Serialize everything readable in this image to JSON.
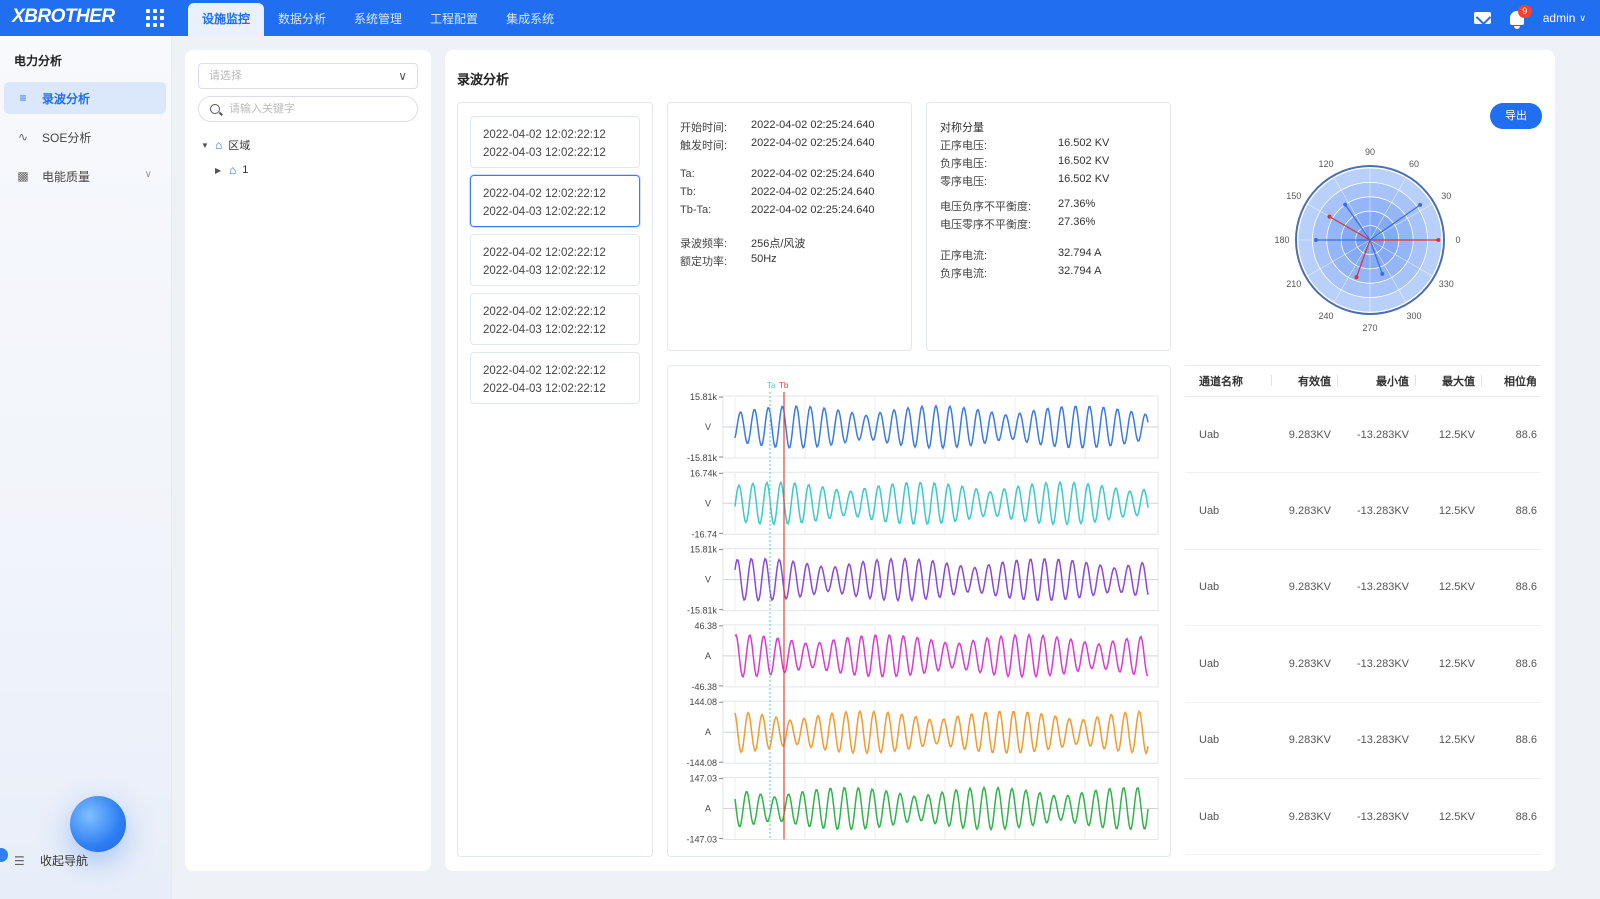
{
  "header": {
    "logo": "XBROTHER",
    "tabs": [
      "设施监控",
      "数据分析",
      "系统管理",
      "工程配置",
      "集成系统"
    ],
    "notification_count": "9",
    "user": "admin"
  },
  "sidebar": {
    "title": "电力分析",
    "items": [
      {
        "label": "录波分析",
        "icon": "list-icon",
        "active": true
      },
      {
        "label": "SOE分析",
        "icon": "wave-icon",
        "active": false
      },
      {
        "label": "电能质量",
        "icon": "meter-icon",
        "active": false
      }
    ],
    "collapse_label": "收起导航"
  },
  "tree": {
    "select_placeholder": "请选择",
    "search_placeholder": "请输入关键字",
    "nodes": [
      {
        "label": "区域",
        "expanded": true
      },
      {
        "label": "1",
        "expanded": false
      }
    ]
  },
  "main": {
    "title": "录波分析",
    "export_label": "导出",
    "records": [
      {
        "start": "2022-04-02 12:02:22:12",
        "end": "2022-04-03 12:02:22:12"
      },
      {
        "start": "2022-04-02 12:02:22:12",
        "end": "2022-04-03 12:02:22:12"
      },
      {
        "start": "2022-04-02 12:02:22:12",
        "end": "2022-04-03 12:02:22:12"
      },
      {
        "start": "2022-04-02 12:02:22:12",
        "end": "2022-04-03 12:02:22:12"
      },
      {
        "start": "2022-04-02 12:02:22:12",
        "end": "2022-04-03 12:02:22:12"
      }
    ],
    "selected_record": 1,
    "info": [
      {
        "key": "开始时间:",
        "value": "2022-04-02 02:25:24.640"
      },
      {
        "key": "触发时间:",
        "value": "2022-04-02 02:25:24.640"
      },
      {
        "key": "Ta:",
        "value": "2022-04-02 02:25:24.640"
      },
      {
        "key": "Tb:",
        "value": "2022-04-02 02:25:24.640"
      },
      {
        "key": "Tb-Ta:",
        "value": "2022-04-02 02:25:24.640"
      },
      {
        "key": "录波频率:",
        "value": "256点/风波"
      },
      {
        "key": "额定功率:",
        "value": "50Hz"
      }
    ],
    "symmetric": {
      "title": "对称分量",
      "rows": [
        {
          "key": "正序电压:",
          "value": "16.502 KV"
        },
        {
          "key": "负序电压:",
          "value": "16.502 KV"
        },
        {
          "key": "零序电压:",
          "value": "16.502 KV"
        },
        {
          "key": "电压负序不平衡度:",
          "value": "27.36%"
        },
        {
          "key": "电压零序不平衡度:",
          "value": "27.36%"
        },
        {
          "key": "正序电流:",
          "value": "32.794 A"
        },
        {
          "key": "负序电流:",
          "value": "32.794 A"
        }
      ]
    },
    "polar": {
      "angle_labels": [
        "0",
        "30",
        "60",
        "90",
        "120",
        "150",
        "180",
        "210",
        "240",
        "270",
        "300",
        "330"
      ],
      "vectors": [
        {
          "angle": 35,
          "magnitude": 0.85,
          "color": "#3a6fe0"
        },
        {
          "angle": 0,
          "magnitude": 0.95,
          "color": "#e03030"
        },
        {
          "angle": 150,
          "magnitude": 0.65,
          "color": "#e03030"
        },
        {
          "angle": 180,
          "magnitude": 0.75,
          "color": "#3a6fe0"
        },
        {
          "angle": 250,
          "magnitude": 0.55,
          "color": "#e03030"
        },
        {
          "angle": 290,
          "magnitude": 0.5,
          "color": "#3a6fe0"
        },
        {
          "angle": 125,
          "magnitude": 0.6,
          "color": "#3a6fe0"
        }
      ]
    },
    "table": {
      "headers": [
        "通道名称",
        "有效值",
        "最小值",
        "最大值",
        "相位角"
      ],
      "rows": [
        [
          "Uab",
          "9.283KV",
          "-13.283KV",
          "12.5KV",
          "88.6"
        ],
        [
          "Uab",
          "9.283KV",
          "-13.283KV",
          "12.5KV",
          "88.6"
        ],
        [
          "Uab",
          "9.283KV",
          "-13.283KV",
          "12.5KV",
          "88.6"
        ],
        [
          "Uab",
          "9.283KV",
          "-13.283KV",
          "12.5KV",
          "88.6"
        ],
        [
          "Uab",
          "9.283KV",
          "-13.283KV",
          "12.5KV",
          "88.6"
        ],
        [
          "Uab",
          "9.283KV",
          "-13.283KV",
          "12.5KV",
          "88.6"
        ]
      ]
    }
  },
  "chart_data": {
    "type": "line",
    "markers": [
      {
        "label": "Ta",
        "color": "#5bc0de"
      },
      {
        "label": "Tb",
        "color": "#e0453a"
      }
    ],
    "series": [
      {
        "unit": "V",
        "max_label": "15.81k",
        "min_label": "-15.81k",
        "color": "#3b7be0"
      },
      {
        "unit": "V",
        "max_label": "16.74k",
        "min_label": "-16.74",
        "color": "#3cc9c9"
      },
      {
        "unit": "V",
        "max_label": "15.81k",
        "min_label": "-15.81k",
        "color": "#8a49d6"
      },
      {
        "unit": "A",
        "max_label": "46.38",
        "min_label": "-46.38",
        "color": "#d73cd0"
      },
      {
        "unit": "A",
        "max_label": "144.08",
        "min_label": "-144.08",
        "color": "#f29a2e"
      },
      {
        "unit": "A",
        "max_label": "147.03",
        "min_label": "-147.03",
        "color": "#2fb34a"
      }
    ]
  }
}
